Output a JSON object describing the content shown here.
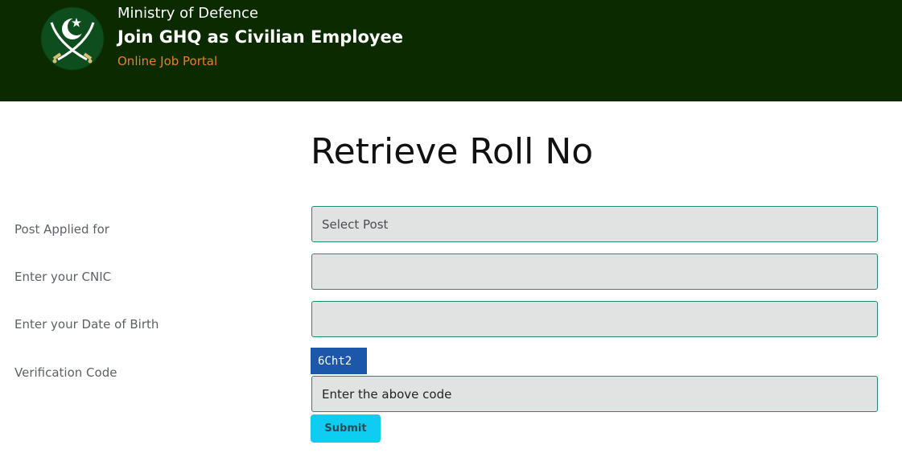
{
  "header": {
    "ministry": "Ministry of Defence",
    "title": "Join GHQ as Civilian Employee",
    "subtitle": "Online Job Portal",
    "logo": "crescent-star-crossed-swords-emblem"
  },
  "page_title": "Retrieve Roll No",
  "form": {
    "post_label": "Post Applied for",
    "post_select": "Select Post",
    "cnic_label": "Enter your CNIC",
    "cnic_value": "",
    "dob_label": "Enter your Date of Birth",
    "dob_value": "",
    "verification_label": "Verification Code",
    "captcha_code": "6Cht2",
    "code_placeholder": "Enter the above code",
    "submit_label": "Submit"
  },
  "colors": {
    "header_bg": "#0b2a00",
    "subtitle": "#f07d1c",
    "field_border": "#1f8a70",
    "field_bg": "#e1e3e3",
    "captcha_bg": "#1c57a9",
    "submit_bg": "#0ecdf0"
  }
}
